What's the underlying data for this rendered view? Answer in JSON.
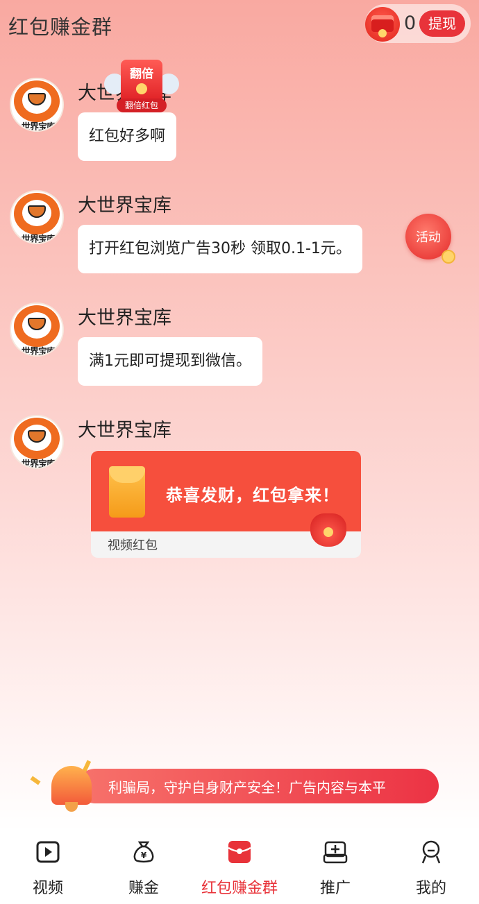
{
  "header": {
    "title": "红包赚金群",
    "wallet_amount": "0",
    "withdraw_label": "提现"
  },
  "messages": [
    {
      "sender": "大世界宝库",
      "text": "红包好多啊",
      "avatar_text": "世界宝库"
    },
    {
      "sender": "大世界宝库",
      "text": "打开红包浏览广告30秒 领取0.1-1元。",
      "avatar_text": "世界宝库"
    },
    {
      "sender": "大世界宝库",
      "text": "满1元即可提现到微信。",
      "avatar_text": "世界宝库"
    },
    {
      "sender": "大世界宝库",
      "avatar_text": "世界宝库"
    }
  ],
  "double_badge": {
    "top": "翻倍",
    "bottom": "翻倍红包"
  },
  "activity_label": "活动",
  "red_envelope_card": {
    "title": "恭喜发财，红包拿来！",
    "label": "视频红包"
  },
  "notice_text": "利骗局，守护自身财产安全！广告内容与本平",
  "bottom_nav": [
    {
      "label": "视频",
      "icon": "video-play-icon"
    },
    {
      "label": "赚金",
      "icon": "money-bag-icon"
    },
    {
      "label": "红包赚金群",
      "icon": "red-envelope-icon",
      "active": true
    },
    {
      "label": "推广",
      "icon": "promote-box-icon"
    },
    {
      "label": "我的",
      "icon": "user-profile-icon"
    }
  ],
  "colors": {
    "accent": "#e8333a",
    "card_red": "#f64f3d"
  }
}
